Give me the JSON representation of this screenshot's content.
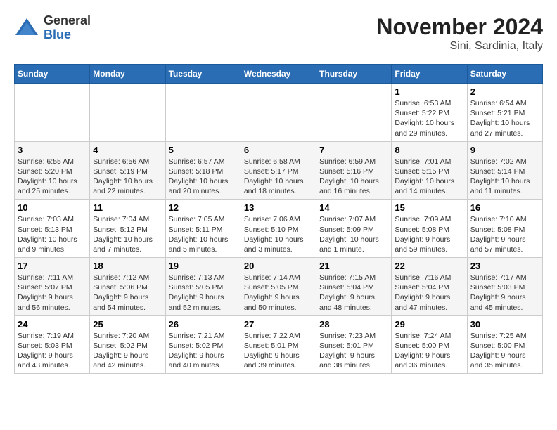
{
  "logo": {
    "general": "General",
    "blue": "Blue"
  },
  "title": "November 2024",
  "subtitle": "Sini, Sardinia, Italy",
  "weekdays": [
    "Sunday",
    "Monday",
    "Tuesday",
    "Wednesday",
    "Thursday",
    "Friday",
    "Saturday"
  ],
  "weeks": [
    [
      {
        "day": "",
        "info": ""
      },
      {
        "day": "",
        "info": ""
      },
      {
        "day": "",
        "info": ""
      },
      {
        "day": "",
        "info": ""
      },
      {
        "day": "",
        "info": ""
      },
      {
        "day": "1",
        "info": "Sunrise: 6:53 AM\nSunset: 5:22 PM\nDaylight: 10 hours and 29 minutes."
      },
      {
        "day": "2",
        "info": "Sunrise: 6:54 AM\nSunset: 5:21 PM\nDaylight: 10 hours and 27 minutes."
      }
    ],
    [
      {
        "day": "3",
        "info": "Sunrise: 6:55 AM\nSunset: 5:20 PM\nDaylight: 10 hours and 25 minutes."
      },
      {
        "day": "4",
        "info": "Sunrise: 6:56 AM\nSunset: 5:19 PM\nDaylight: 10 hours and 22 minutes."
      },
      {
        "day": "5",
        "info": "Sunrise: 6:57 AM\nSunset: 5:18 PM\nDaylight: 10 hours and 20 minutes."
      },
      {
        "day": "6",
        "info": "Sunrise: 6:58 AM\nSunset: 5:17 PM\nDaylight: 10 hours and 18 minutes."
      },
      {
        "day": "7",
        "info": "Sunrise: 6:59 AM\nSunset: 5:16 PM\nDaylight: 10 hours and 16 minutes."
      },
      {
        "day": "8",
        "info": "Sunrise: 7:01 AM\nSunset: 5:15 PM\nDaylight: 10 hours and 14 minutes."
      },
      {
        "day": "9",
        "info": "Sunrise: 7:02 AM\nSunset: 5:14 PM\nDaylight: 10 hours and 11 minutes."
      }
    ],
    [
      {
        "day": "10",
        "info": "Sunrise: 7:03 AM\nSunset: 5:13 PM\nDaylight: 10 hours and 9 minutes."
      },
      {
        "day": "11",
        "info": "Sunrise: 7:04 AM\nSunset: 5:12 PM\nDaylight: 10 hours and 7 minutes."
      },
      {
        "day": "12",
        "info": "Sunrise: 7:05 AM\nSunset: 5:11 PM\nDaylight: 10 hours and 5 minutes."
      },
      {
        "day": "13",
        "info": "Sunrise: 7:06 AM\nSunset: 5:10 PM\nDaylight: 10 hours and 3 minutes."
      },
      {
        "day": "14",
        "info": "Sunrise: 7:07 AM\nSunset: 5:09 PM\nDaylight: 10 hours and 1 minute."
      },
      {
        "day": "15",
        "info": "Sunrise: 7:09 AM\nSunset: 5:08 PM\nDaylight: 9 hours and 59 minutes."
      },
      {
        "day": "16",
        "info": "Sunrise: 7:10 AM\nSunset: 5:08 PM\nDaylight: 9 hours and 57 minutes."
      }
    ],
    [
      {
        "day": "17",
        "info": "Sunrise: 7:11 AM\nSunset: 5:07 PM\nDaylight: 9 hours and 56 minutes."
      },
      {
        "day": "18",
        "info": "Sunrise: 7:12 AM\nSunset: 5:06 PM\nDaylight: 9 hours and 54 minutes."
      },
      {
        "day": "19",
        "info": "Sunrise: 7:13 AM\nSunset: 5:05 PM\nDaylight: 9 hours and 52 minutes."
      },
      {
        "day": "20",
        "info": "Sunrise: 7:14 AM\nSunset: 5:05 PM\nDaylight: 9 hours and 50 minutes."
      },
      {
        "day": "21",
        "info": "Sunrise: 7:15 AM\nSunset: 5:04 PM\nDaylight: 9 hours and 48 minutes."
      },
      {
        "day": "22",
        "info": "Sunrise: 7:16 AM\nSunset: 5:04 PM\nDaylight: 9 hours and 47 minutes."
      },
      {
        "day": "23",
        "info": "Sunrise: 7:17 AM\nSunset: 5:03 PM\nDaylight: 9 hours and 45 minutes."
      }
    ],
    [
      {
        "day": "24",
        "info": "Sunrise: 7:19 AM\nSunset: 5:03 PM\nDaylight: 9 hours and 43 minutes."
      },
      {
        "day": "25",
        "info": "Sunrise: 7:20 AM\nSunset: 5:02 PM\nDaylight: 9 hours and 42 minutes."
      },
      {
        "day": "26",
        "info": "Sunrise: 7:21 AM\nSunset: 5:02 PM\nDaylight: 9 hours and 40 minutes."
      },
      {
        "day": "27",
        "info": "Sunrise: 7:22 AM\nSunset: 5:01 PM\nDaylight: 9 hours and 39 minutes."
      },
      {
        "day": "28",
        "info": "Sunrise: 7:23 AM\nSunset: 5:01 PM\nDaylight: 9 hours and 38 minutes."
      },
      {
        "day": "29",
        "info": "Sunrise: 7:24 AM\nSunset: 5:00 PM\nDaylight: 9 hours and 36 minutes."
      },
      {
        "day": "30",
        "info": "Sunrise: 7:25 AM\nSunset: 5:00 PM\nDaylight: 9 hours and 35 minutes."
      }
    ]
  ]
}
